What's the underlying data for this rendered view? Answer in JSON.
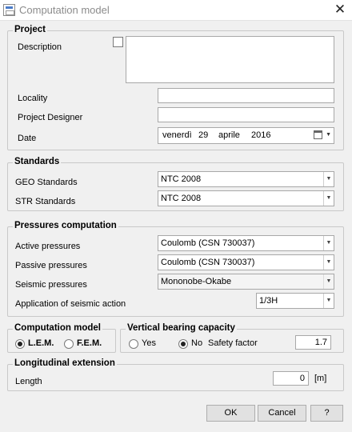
{
  "window": {
    "title": "Computation model",
    "close_symbol": "✕"
  },
  "project": {
    "legend": "Project",
    "description_label": "Description",
    "description_value": "",
    "locality_label": "Locality",
    "locality_value": "",
    "designer_label": "Project Designer",
    "designer_value": "",
    "date_label": "Date",
    "date": {
      "weekday": "venerdì",
      "day": "29",
      "month": "aprile",
      "year": "2016"
    }
  },
  "standards": {
    "legend": "Standards",
    "geo_label": "GEO Standards",
    "geo_value": "NTC 2008",
    "str_label": "STR Standards",
    "str_value": "NTC 2008"
  },
  "pressures": {
    "legend": "Pressures computation",
    "active_label": "Active pressures",
    "active_value": "Coulomb (CSN 730037)",
    "passive_label": "Passive pressures",
    "passive_value": "Coulomb (CSN 730037)",
    "seismic_label": "Seismic pressures",
    "seismic_value": "Mononobe-Okabe",
    "seismic_action_label": "Application of seismic action",
    "seismic_action_value": "1/3H"
  },
  "computation_model": {
    "legend": "Computation model",
    "options": [
      {
        "label": "L.E.M.",
        "selected": true
      },
      {
        "label": "F.E.M.",
        "selected": false
      }
    ]
  },
  "bearing_capacity": {
    "legend": "Vertical bearing capacity",
    "yes_label": "Yes",
    "no_label": "No",
    "selected": "No",
    "safety_factor_label": "Safety factor",
    "safety_factor_value": "1.7"
  },
  "longitudinal": {
    "legend": "Longitudinal extension",
    "length_label": "Length",
    "length_value": "0",
    "unit": "[m]"
  },
  "buttons": {
    "ok": "OK",
    "cancel": "Cancel",
    "help": "?"
  },
  "icons": {
    "dropdown": "chevron-down-icon",
    "calendar": "calendar-icon",
    "app": "app-window-icon",
    "close": "close-icon"
  }
}
